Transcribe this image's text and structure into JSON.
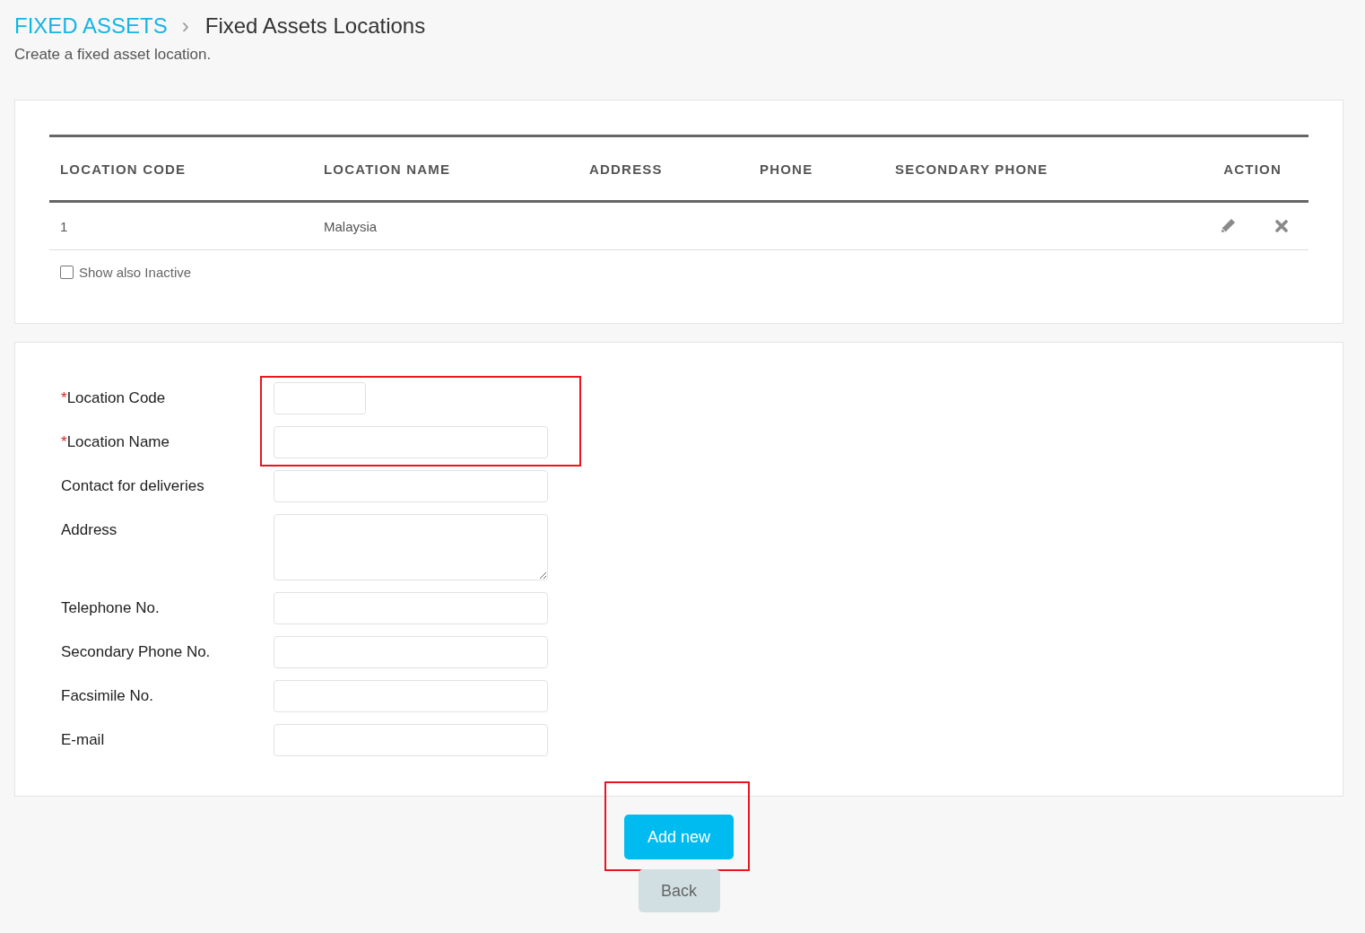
{
  "breadcrumb": {
    "parent": "FIXED ASSETS",
    "separator": "›",
    "current": "Fixed Assets Locations"
  },
  "subtitle": "Create a fixed asset location.",
  "table": {
    "columns": [
      "LOCATION CODE",
      "LOCATION NAME",
      "ADDRESS",
      "PHONE",
      "SECONDARY PHONE",
      "ACTION"
    ],
    "rows": [
      {
        "location_code": "1",
        "location_name": "Malaysia"
      }
    ]
  },
  "show_inactive": {
    "label": "Show also Inactive",
    "checked": false
  },
  "form": {
    "fields": [
      {
        "label": "Location Code",
        "required_mark": "*",
        "kind": "short",
        "highlighted": true
      },
      {
        "label": "Location Name",
        "required_mark": "*",
        "kind": "text",
        "highlighted": true
      },
      {
        "label": "Contact for deliveries",
        "kind": "text",
        "highlighted": false
      },
      {
        "label": "Address",
        "kind": "textarea",
        "highlighted": false
      },
      {
        "label": "Telephone No.",
        "kind": "text",
        "highlighted": false
      },
      {
        "label": "Secondary Phone No.",
        "kind": "text",
        "highlighted": false
      },
      {
        "label": "Facsimile No.",
        "kind": "text",
        "highlighted": false
      },
      {
        "label": "E-mail",
        "kind": "text",
        "highlighted": false
      }
    ]
  },
  "buttons": [
    {
      "label": "Add new",
      "kind": "primary",
      "highlighted": true
    },
    {
      "label": "Back",
      "kind": "secondary",
      "highlighted": false
    }
  ]
}
